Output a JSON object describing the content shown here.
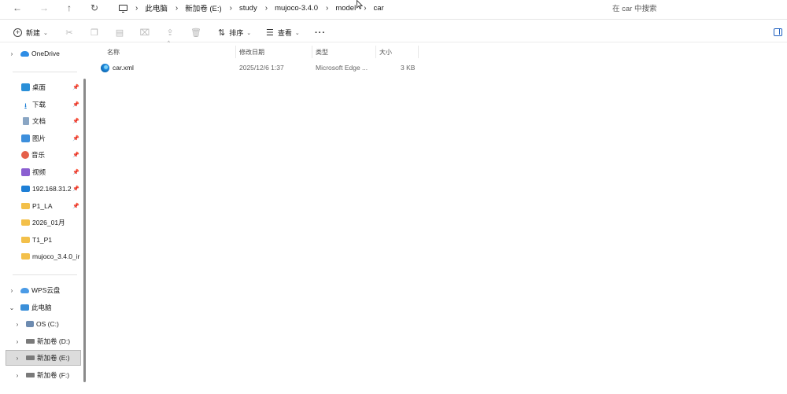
{
  "address_bar": {
    "nav": {
      "back": "←",
      "forward": "→",
      "up": "↑",
      "refresh": "↻"
    },
    "breadcrumbs": [
      "此电脑",
      "新加卷 (E:)",
      "study",
      "mujoco-3.4.0",
      "model",
      "car"
    ],
    "separator": "›",
    "search_placeholder": "在 car 中搜索"
  },
  "toolbar": {
    "new_label": "新建",
    "sort_label": "排序",
    "view_label": "查看",
    "more_label": "···"
  },
  "sidebar": {
    "onedrive": "OneDrive",
    "quick_access": [
      {
        "label": "桌面",
        "icon": "desktop-icon"
      },
      {
        "label": "下载",
        "icon": "download-icon"
      },
      {
        "label": "文档",
        "icon": "document-icon"
      },
      {
        "label": "图片",
        "icon": "pictures-icon"
      },
      {
        "label": "音乐",
        "icon": "music-icon"
      },
      {
        "label": "视频",
        "icon": "video-icon"
      },
      {
        "label": "192.168.31.2",
        "icon": "network-icon"
      },
      {
        "label": "P1_LA",
        "icon": "folder-icon"
      },
      {
        "label": "2026_01月",
        "icon": "folder-icon"
      },
      {
        "label": "T1_P1",
        "icon": "folder-icon"
      },
      {
        "label": "mujoco_3.4.0_ir",
        "icon": "folder-icon"
      }
    ],
    "wps": "WPS云盘",
    "this_pc": "此电脑",
    "drives": [
      {
        "label": "OS (C:)"
      },
      {
        "label": "新加卷 (D:)"
      },
      {
        "label": "新加卷 (E:)"
      },
      {
        "label": "新加卷 (F:)"
      }
    ]
  },
  "file_list": {
    "columns": [
      "名称",
      "修改日期",
      "类型",
      "大小"
    ],
    "rows": [
      {
        "name": "car.xml",
        "modified": "2025/12/6 1:37",
        "type": "Microsoft Edge ...",
        "size": "3 KB"
      }
    ]
  }
}
